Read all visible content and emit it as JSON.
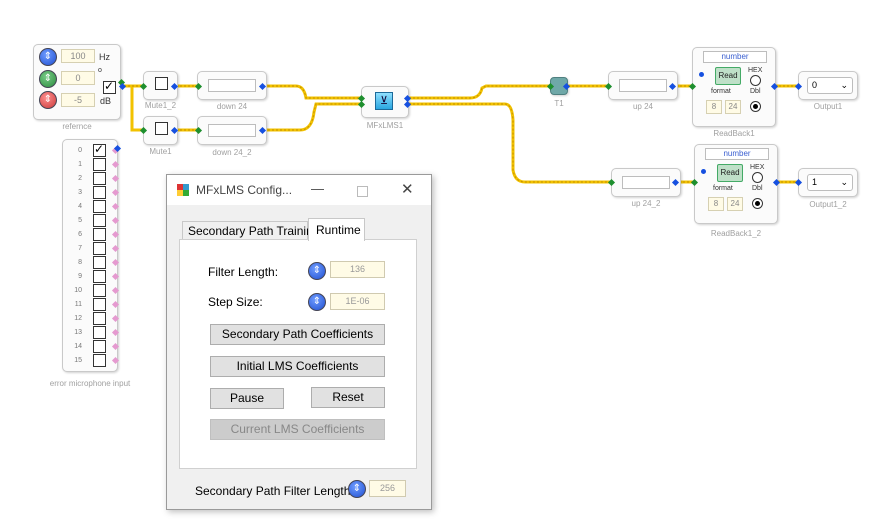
{
  "reference": {
    "label": "refernce",
    "freq_value": "100",
    "freq_unit": "Hz",
    "phase_value": "0",
    "phase_unit": "o",
    "gain_value": "-5",
    "gain_unit": "dB"
  },
  "mute1_2": {
    "label": "Mute1_2"
  },
  "mute1": {
    "label": "Mute1"
  },
  "down24": {
    "label": "down 24"
  },
  "down24_2": {
    "label": "down 24_2"
  },
  "mfxlms": {
    "label": "MFxLMS1"
  },
  "t1": {
    "label": "T1"
  },
  "up24": {
    "label": "up 24"
  },
  "up24_2": {
    "label": "up 24_2"
  },
  "readback1": {
    "label": "ReadBack1",
    "title": "number",
    "read": "Read",
    "format": "format",
    "hex": "HEX",
    "dbl": "Dbl",
    "v1": "8",
    "v2": "24"
  },
  "readback1_2": {
    "label": "ReadBack1_2",
    "title": "number",
    "read": "Read",
    "format": "format",
    "hex": "HEX",
    "dbl": "Dbl",
    "v1": "8",
    "v2": "24"
  },
  "output1": {
    "label": "Output1",
    "value": "0"
  },
  "output1_2": {
    "label": "Output1_2",
    "value": "1"
  },
  "error_mic": {
    "label": "error microphone input",
    "channels": [
      "0",
      "1",
      "2",
      "3",
      "4",
      "5",
      "6",
      "7",
      "8",
      "9",
      "10",
      "11",
      "12",
      "13",
      "14",
      "15"
    ]
  },
  "dialog": {
    "title": "MFxLMS Config...",
    "tabs": [
      "Secondary Path Training",
      "Runtime"
    ],
    "filter_length_label": "Filter Length:",
    "filter_length_value": "136",
    "step_size_label": "Step Size:",
    "step_size_value": "1E-06",
    "btn_secondary_coeffs": "Secondary Path Coefficients",
    "btn_initial_lms": "Initial LMS Coefficients",
    "btn_pause": "Pause",
    "btn_reset": "Reset",
    "btn_current_lms": "Current LMS Coefficients",
    "sec_filter_len_label": "Secondary Path Filter Length:",
    "sec_filter_len_value": "256"
  },
  "colors": {
    "wire": "#f0c000",
    "pin_in": "#1e8f2e",
    "pin_out": "#1650e0",
    "accent": "#3a5fd0"
  }
}
